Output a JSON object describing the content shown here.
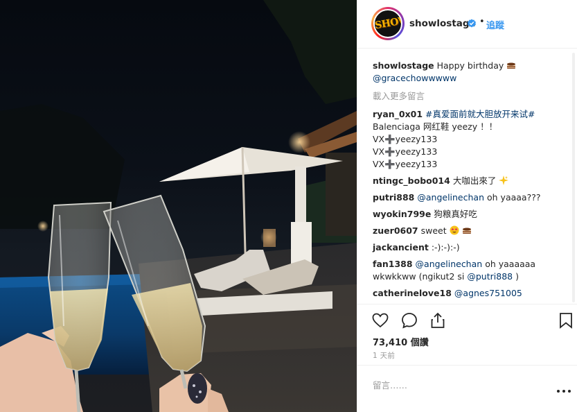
{
  "post": {
    "username": "showlostage",
    "follow_label": "追蹤",
    "separator": "•",
    "avatar_text": "SHOW",
    "avatar_text_color": "#f4b000",
    "verified_icon": "verified-badge-icon"
  },
  "caption": {
    "username": "showlostage",
    "text": "Happy birthday",
    "emoji": "cake-emoji",
    "mention": "@gracechowwwww"
  },
  "load_more": "載入更多留言",
  "comments": [
    {
      "user": "ryan_0x01",
      "lines": [
        "#真爱面前就大胆放开来试#",
        "Balenciaga 网红鞋 yeezy ！！",
        "VX➕yeezy133",
        "VX➕yeezy133",
        "VX➕yeezy133"
      ]
    },
    {
      "user": "ntingc_bobo014",
      "text": "大咖出來了",
      "emoji": "sparkle-emoji"
    },
    {
      "user": "putri888",
      "mention": "@angelinechan",
      "text": "oh yaaaa???"
    },
    {
      "user": "wyokin799e",
      "text": "狗粮真好吃"
    },
    {
      "user": "zuer0607",
      "text": "sweet",
      "emojis": [
        "star-eyes-emoji",
        "cake-emoji"
      ]
    },
    {
      "user": "jackancient",
      "text": ":-):-):-)"
    },
    {
      "user": "fan1388",
      "mention": "@angelinechan",
      "text": "oh yaaaaaa",
      "line2": "wkwkkww (ngikut2 si",
      "mention2": "@putri888",
      "line2_end": ")"
    },
    {
      "user": "catherinelove18",
      "mention": "@agnes751005"
    }
  ],
  "actions": {
    "like_icon": "heart-icon",
    "comment_icon": "comment-bubble-icon",
    "share_icon": "share-icon",
    "save_icon": "bookmark-icon"
  },
  "likes_text": "73,410 個讚",
  "time_ago": "1 天前",
  "comment_placeholder": "留言……",
  "more_icon": "more-options-icon",
  "colors": {
    "link": "#003569",
    "follow": "#3897f0",
    "muted": "#999999",
    "text": "#262626",
    "border": "#efefef"
  }
}
